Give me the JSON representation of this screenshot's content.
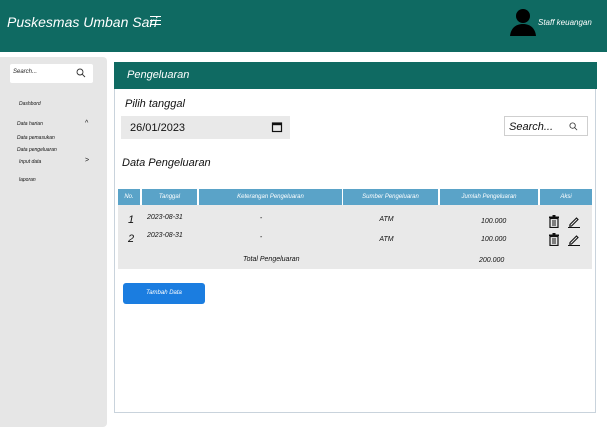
{
  "header": {
    "app_title": "Puskesmas Umban Sari",
    "user_name": "Staff keuangan"
  },
  "sidebar": {
    "search_placeholder": "Search...",
    "items": [
      {
        "label": "Dashbord"
      },
      {
        "label": "Data harian",
        "arrow": "^"
      },
      {
        "label": "Data pemasukan"
      },
      {
        "label": "Data pengeluaran"
      },
      {
        "label": "Input data",
        "arrow": ">"
      },
      {
        "label": "laporan"
      }
    ]
  },
  "main": {
    "title": "Pengeluaran",
    "date_label": "Pilih tanggal",
    "date_value": "26/01/2023",
    "search_placeholder": "Search...",
    "section_title": "Data Pengeluaran",
    "table": {
      "columns": [
        "No.",
        "Tanggal",
        "Keterangan Pengeluaran",
        "Sumber Pengeluaran",
        "Jumlah Pengeluaran",
        "Aksi"
      ],
      "rows": [
        {
          "no": "1",
          "tanggal": "2023-08-31",
          "keterangan": "-",
          "sumber": "ATM",
          "jumlah": "100.000"
        },
        {
          "no": "2",
          "tanggal": "2023-08-31",
          "keterangan": "-",
          "sumber": "ATM",
          "jumlah": "100.000"
        }
      ],
      "total_label": "Total Pengeluaran",
      "total_value": "200.000"
    },
    "add_button": "Tambah Data"
  },
  "colors": {
    "primary": "#0f6a62",
    "table_header": "#5aa3c8",
    "button": "#1b7de0"
  },
  "icons": {
    "menu": "hamburger-icon",
    "user": "user-avatar-icon",
    "search": "search-icon",
    "calendar": "calendar-icon",
    "delete": "trash-icon",
    "edit": "pencil-icon"
  }
}
